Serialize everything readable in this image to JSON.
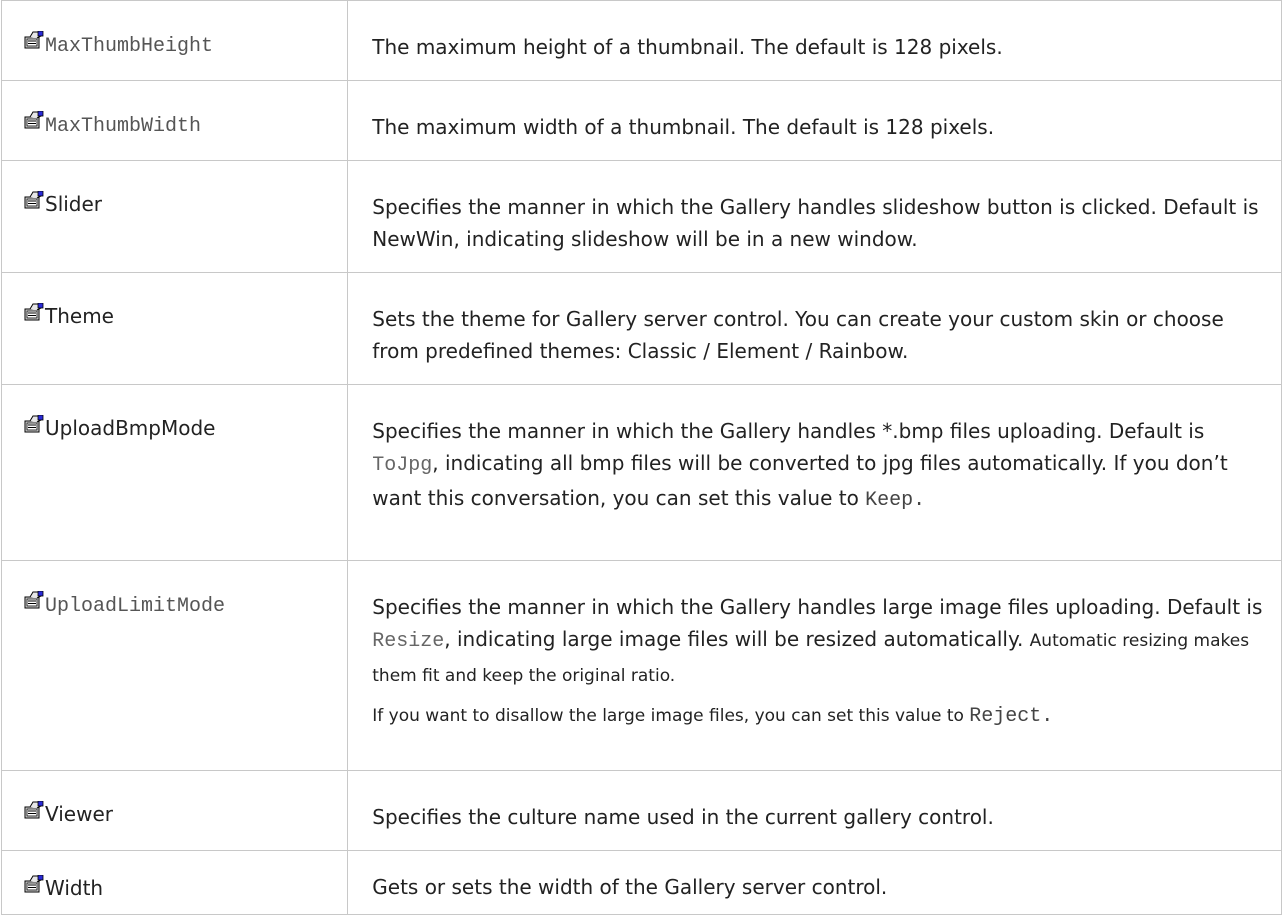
{
  "rows": [
    {
      "name": "MaxThumbHeight",
      "name_style": "mono",
      "desc": "The maximum height of a thumbnail. The default is 128 pixels."
    },
    {
      "name": "MaxThumbWidth",
      "name_style": "mono",
      "desc": "The maximum width of a thumbnail. The default is 128 pixels."
    },
    {
      "name": "Slider",
      "name_style": "sans",
      "desc": "Specifies the manner in which the Gallery handles slideshow button is clicked. Default is NewWin, indicating slideshow will be in a new window."
    },
    {
      "name": "Theme",
      "name_style": "sans",
      "desc": "Sets the theme for Gallery server control. You can create your custom skin or choose from predefined themes: Classic / Element / Rainbow."
    },
    {
      "name": "UploadBmpMode",
      "name_style": "sans",
      "desc_a": "Specifies the manner in which the Gallery handles *.bmp files uploading. Default is ",
      "code_a": "ToJpg",
      "desc_b": ", indicating all bmp files will be converted to jpg files automatically. If you don’t want this conversation, you can set this value to ",
      "code_b": "Keep."
    },
    {
      "name": "UploadLimitMode",
      "name_style": "mono",
      "desc_a": "Specifies the manner in which the Gallery handles large image files uploading. Default is ",
      "code_a": "Resize",
      "desc_b": ", indicating large image files will be resized automatically. ",
      "desc_c": "Automatic resizing makes them fit and keep the original ratio.",
      "note": "If you want to disallow the large image files, you can set this value to ",
      "code_b": "Reject."
    },
    {
      "name": "Viewer",
      "name_style": "sans",
      "desc": "Specifies the culture name used in the current gallery control."
    },
    {
      "name": "Width",
      "name_style": "sans",
      "desc": "Gets or sets the width of the Gallery server control."
    }
  ]
}
